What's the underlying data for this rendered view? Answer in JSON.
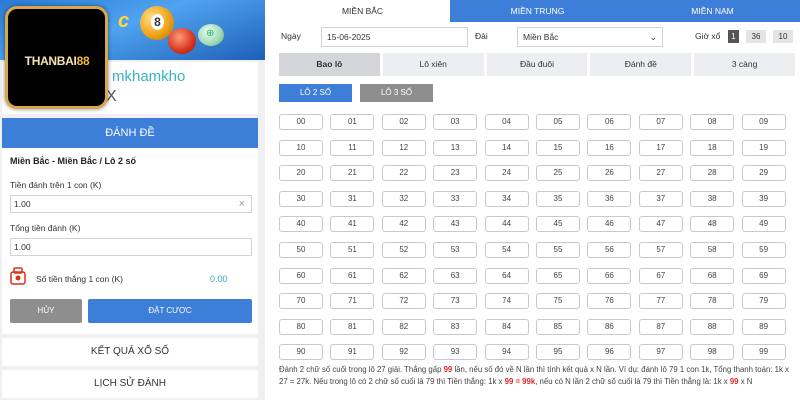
{
  "banner": {
    "text": "c",
    "ball_number": "8",
    "green_ball_text": "⊕"
  },
  "logo": {
    "text_a": "THANBAI",
    "text_b": "88"
  },
  "user": {
    "username": "mkhamkho",
    "close_mark": "X"
  },
  "bet_panel": {
    "header": "ĐÁNH ĐỀ",
    "title": "Miền Bắc - Miền Bắc / Lô 2 số",
    "amount_label": "Tiền đánh trên 1 con (K)",
    "amount_value": "1.00",
    "total_label": "Tổng tiền đánh (K)",
    "total_value": "1.00",
    "win_label": "Số tiền thắng 1 con (K)",
    "win_value": "0.00",
    "cancel_label": "HỦY",
    "place_label": "ĐẶT CƯỢC"
  },
  "nav": {
    "result_label": "KẾT QUẢ XỔ SỐ",
    "history_label": "LỊCH SỬ ĐÁNH"
  },
  "regions": [
    "MIỀN BẮC",
    "MIỀN TRUNG",
    "MIỀN NAM"
  ],
  "filters": {
    "date_label": "Ngày",
    "date_value": "15-06-2025",
    "dai_label": "Đài",
    "dai_value": "Miền Bắc",
    "time_label": "Giờ xổ",
    "time_h": "1",
    "time_m": "36",
    "time_s": "10"
  },
  "game_tabs": [
    "Bao lô",
    "Lô xiên",
    "Đầu đuôi",
    "Đánh đề",
    "3 càng"
  ],
  "lo_tabs": [
    "LÔ 2 SỐ",
    "LÔ 3 SỐ"
  ],
  "numbers": [
    "00",
    "01",
    "02",
    "03",
    "04",
    "05",
    "06",
    "07",
    "08",
    "09",
    "10",
    "11",
    "12",
    "13",
    "14",
    "15",
    "16",
    "17",
    "18",
    "19",
    "20",
    "21",
    "22",
    "23",
    "24",
    "25",
    "26",
    "27",
    "28",
    "29",
    "30",
    "31",
    "32",
    "33",
    "34",
    "35",
    "36",
    "37",
    "38",
    "39",
    "40",
    "41",
    "42",
    "43",
    "44",
    "45",
    "46",
    "47",
    "48",
    "49",
    "50",
    "51",
    "52",
    "53",
    "54",
    "55",
    "56",
    "57",
    "58",
    "59",
    "60",
    "61",
    "62",
    "63",
    "64",
    "65",
    "66",
    "67",
    "68",
    "69",
    "70",
    "71",
    "72",
    "73",
    "74",
    "75",
    "76",
    "77",
    "78",
    "79",
    "80",
    "81",
    "82",
    "83",
    "84",
    "85",
    "86",
    "87",
    "88",
    "89",
    "90",
    "91",
    "92",
    "93",
    "94",
    "95",
    "96",
    "97",
    "98",
    "99"
  ],
  "description": {
    "p1": "Đánh 2 chữ số cuối trong lô 27 giải. Thắng gấp ",
    "h1": "99",
    "p2": " lần, nếu số đó về N lần thì tính kết quả x N lần. Ví dụ: đánh lô 79 1 con 1k, Tổng thanh toán: 1k x 27 = 27k. Nếu trong lô có 2 chữ số cuối là 79 thì Tiền thắng: 1k x ",
    "h2": "99 = 99k",
    "p3": ", nếu có N lần 2 chữ số cuối là 79 thì Tiền thắng là: 1k x ",
    "h3": "99",
    "p4": " x N"
  },
  "colors": {
    "primary": "#3d7fd8",
    "accent_text": "#3bb3c3",
    "highlight": "#e0262d"
  }
}
